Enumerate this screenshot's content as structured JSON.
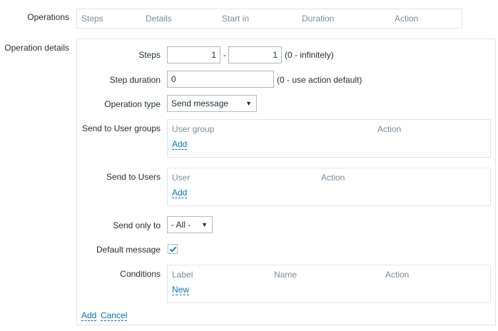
{
  "operations": {
    "label": "Operations",
    "columns": [
      "Steps",
      "Details",
      "Start in",
      "Duration",
      "Action"
    ]
  },
  "details": {
    "label": "Operation details",
    "steps": {
      "label": "Steps",
      "from": "1",
      "separator": "-",
      "to": "1",
      "hint": "(0 - infinitely)"
    },
    "step_duration": {
      "label": "Step duration",
      "value": "0",
      "hint": "(0 - use action default)"
    },
    "operation_type": {
      "label": "Operation type",
      "value": "Send message"
    },
    "user_groups": {
      "label": "Send to User groups",
      "col1": "User group",
      "col2": "Action",
      "add": "Add"
    },
    "users": {
      "label": "Send to Users",
      "col1": "User",
      "col2": "Action",
      "add": "Add"
    },
    "send_only_to": {
      "label": "Send only to",
      "value": "- All -"
    },
    "default_message": {
      "label": "Default message",
      "checked": true
    },
    "conditions": {
      "label": "Conditions",
      "col1": "Label",
      "col2": "Name",
      "col3": "Action",
      "new": "New"
    },
    "footer": {
      "add": "Add",
      "cancel": "Cancel"
    }
  },
  "icons": {
    "dropdown": "triangle-down-icon",
    "check": "checkmark-icon"
  },
  "colors": {
    "link": "#0275b8",
    "check": "#0275b8",
    "border": "#dfe4e7"
  }
}
